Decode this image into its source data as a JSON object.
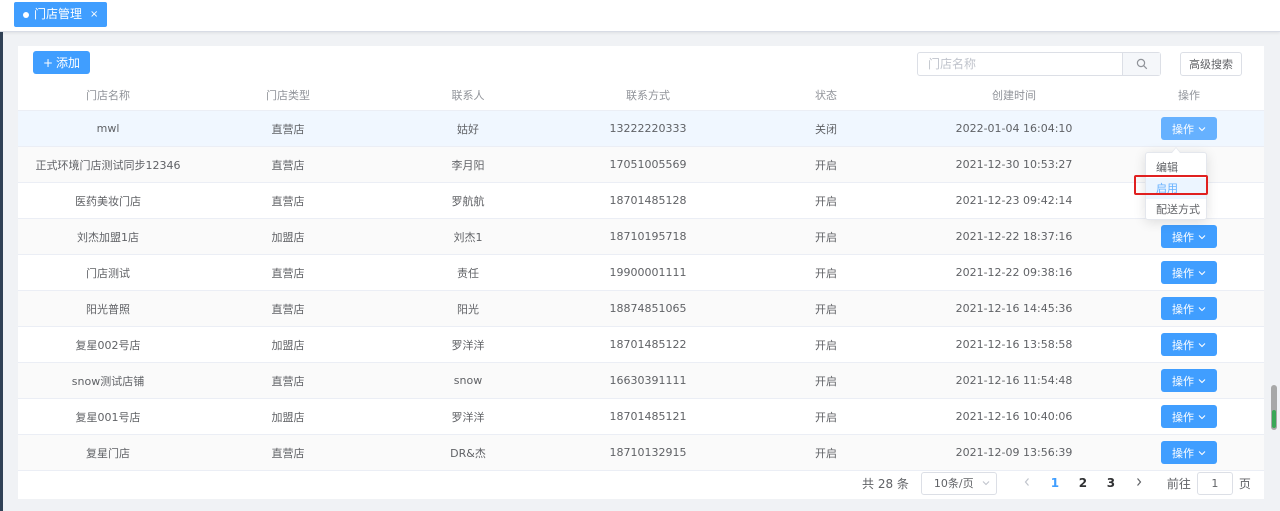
{
  "tab": {
    "label": "门店管理",
    "close": "×"
  },
  "toolbar": {
    "add_icon": "+",
    "add_label": "添加",
    "search_placeholder": "门店名称",
    "advanced_label": "高级搜索"
  },
  "table": {
    "headers": [
      "门店名称",
      "门店类型",
      "联系人",
      "联系方式",
      "状态",
      "创建时间",
      "操作"
    ],
    "rows": [
      {
        "name": "mwl",
        "type": "直营店",
        "contact": "姑好",
        "phone": "13222220333",
        "status": "关闭",
        "created": "2022-01-04 16:04:10"
      },
      {
        "name": "正式环境门店测试同步12346",
        "type": "直营店",
        "contact": "李月阳",
        "phone": "17051005569",
        "status": "开启",
        "created": "2021-12-30 10:53:27"
      },
      {
        "name": "医药美妆门店",
        "type": "直营店",
        "contact": "罗航航",
        "phone": "18701485128",
        "status": "开启",
        "created": "2021-12-23 09:42:14"
      },
      {
        "name": "刘杰加盟1店",
        "type": "加盟店",
        "contact": "刘杰1",
        "phone": "18710195718",
        "status": "开启",
        "created": "2021-12-22 18:37:16"
      },
      {
        "name": "门店测试",
        "type": "直营店",
        "contact": "责任",
        "phone": "19900001111",
        "status": "开启",
        "created": "2021-12-22 09:38:16"
      },
      {
        "name": "阳光普照",
        "type": "直营店",
        "contact": "阳光",
        "phone": "18874851065",
        "status": "开启",
        "created": "2021-12-16 14:45:36"
      },
      {
        "name": "复星002号店",
        "type": "加盟店",
        "contact": "罗洋洋",
        "phone": "18701485122",
        "status": "开启",
        "created": "2021-12-16 13:58:58"
      },
      {
        "name": "snow测试店铺",
        "type": "直营店",
        "contact": "snow",
        "phone": "16630391111",
        "status": "开启",
        "created": "2021-12-16 11:54:48"
      },
      {
        "name": "复星001号店",
        "type": "加盟店",
        "contact": "罗洋洋",
        "phone": "18701485121",
        "status": "开启",
        "created": "2021-12-16 10:40:06"
      },
      {
        "name": "复星门店",
        "type": "直营店",
        "contact": "DR&杰",
        "phone": "18710132915",
        "status": "开启",
        "created": "2021-12-09 13:56:39"
      }
    ],
    "action_label": "操作"
  },
  "dropdown": {
    "items": [
      "编辑",
      "启用",
      "配送方式"
    ]
  },
  "pagination": {
    "total": "共 28 条",
    "page_size": "10条/页",
    "pages": [
      "1",
      "2",
      "3"
    ],
    "goto_label": "前往",
    "goto_value": "1",
    "page_unit": "页"
  },
  "colors": {
    "primary": "#409eff",
    "highlight": "#e02020"
  }
}
